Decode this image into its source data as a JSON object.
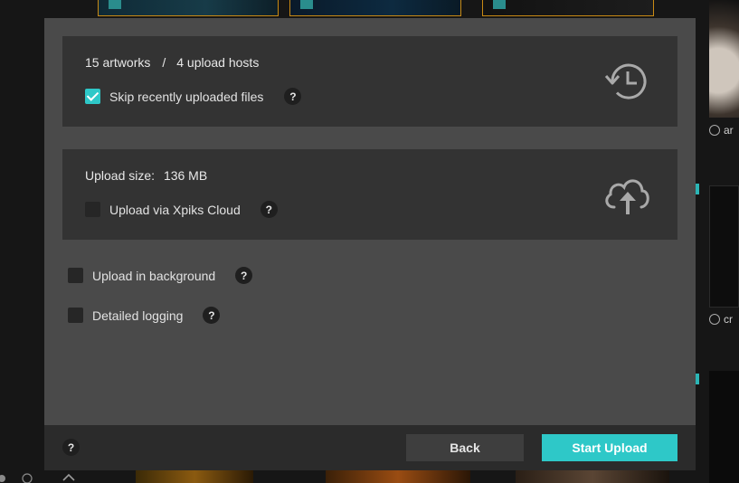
{
  "colors": {
    "accent": "#2ec8c8",
    "dialog_bg": "#4a4a4a",
    "panel_bg": "#333333",
    "footer_bg": "#2b2b2b"
  },
  "summary": {
    "artworks": "15 artworks",
    "separator": "/",
    "hosts": "4 upload hosts",
    "icon": "history-icon"
  },
  "skip_recent": {
    "label": "Skip recently uploaded files",
    "checked": true,
    "help": "?"
  },
  "upload_size": {
    "label": "Upload size:",
    "value": "136 MB",
    "icon": "cloud-upload-icon"
  },
  "xpiks_cloud": {
    "label": "Upload via Xpiks Cloud",
    "checked": false,
    "help": "?"
  },
  "background": {
    "label": "Upload in background",
    "checked": false,
    "help": "?"
  },
  "logging": {
    "label": "Detailed logging",
    "checked": false,
    "help": "?"
  },
  "footer": {
    "help": "?",
    "back_label": "Back",
    "start_label": "Start Upload"
  },
  "background_ui": {
    "right_label_1": "ar",
    "right_label_2": "cr"
  }
}
